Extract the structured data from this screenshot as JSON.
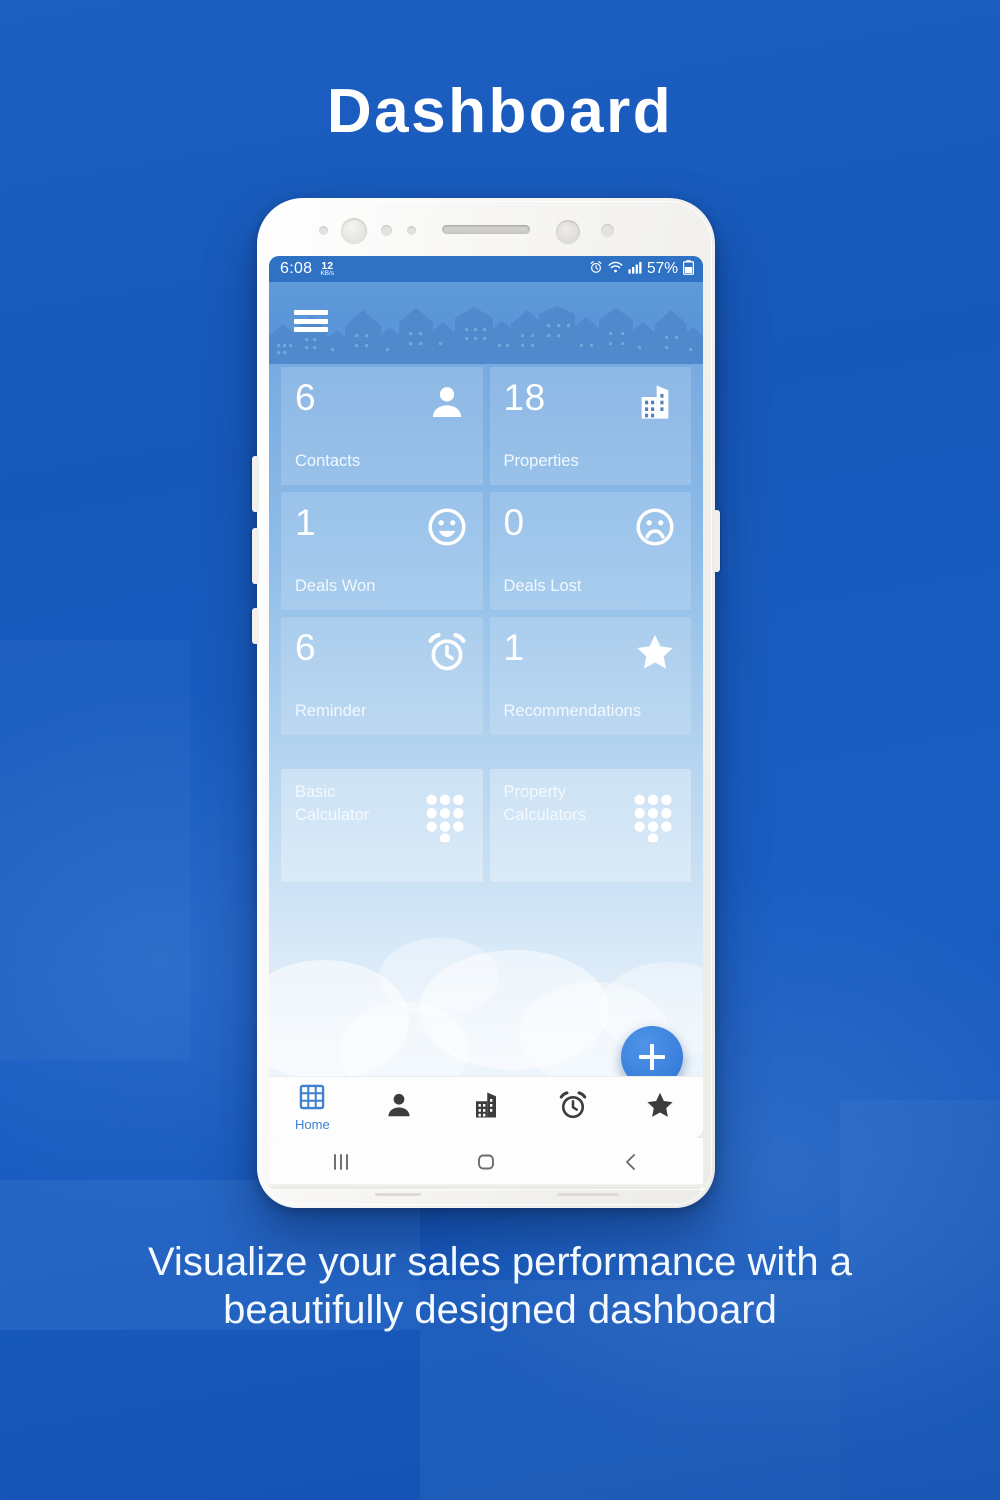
{
  "headline": "Dashboard",
  "caption": "Visualize your sales performance with a beautifully designed dashboard",
  "colors": {
    "background_blue": "#1759bb",
    "accent_blue": "#3c82dd",
    "tile_blue": "#5580c0",
    "calc_tile_blue": "#95b8dd",
    "appbar_blue": "#5793d6",
    "statusbar_blue": "#2f72c4",
    "nav_active_blue": "#3d7fd0"
  },
  "phone": {
    "status_bar": {
      "time": "6:08",
      "net_speed_value": "12",
      "net_speed_unit": "KB/s",
      "alarm_icon": "alarm-icon",
      "wifi_icon": "wifi-icon",
      "signal_icon": "signal-bars-icon",
      "battery_percent": "57%",
      "battery_icon": "battery-icon"
    },
    "app_bar": {
      "menu_icon": "hamburger-menu-icon",
      "banner_art": "city-skyline-silhouette"
    },
    "tiles": [
      {
        "value": "6",
        "label": "Contacts",
        "icon": "person-icon",
        "kind": "stat"
      },
      {
        "value": "18",
        "label": "Properties",
        "icon": "building-icon",
        "kind": "stat"
      },
      {
        "value": "1",
        "label": "Deals Won",
        "icon": "happy-face-icon",
        "kind": "stat"
      },
      {
        "value": "0",
        "label": "Deals Lost",
        "icon": "sad-face-icon",
        "kind": "stat"
      },
      {
        "value": "6",
        "label": "Reminder",
        "icon": "alarm-clock-icon",
        "kind": "stat"
      },
      {
        "value": "1",
        "label": "Recommendations",
        "icon": "star-icon",
        "kind": "stat"
      }
    ],
    "calc_tiles": [
      {
        "line1": "Basic",
        "line2": "Calculator",
        "icon": "keypad-dots-icon"
      },
      {
        "line1": "Property",
        "line2": "Calculators",
        "icon": "keypad-dots-icon"
      }
    ],
    "fab": {
      "label": "+",
      "icon": "plus-icon"
    },
    "bottom_nav": [
      {
        "label": "Home",
        "icon": "grid-home-icon",
        "active": true
      },
      {
        "label": "",
        "icon": "person-icon",
        "active": false
      },
      {
        "label": "",
        "icon": "building-icon",
        "active": false
      },
      {
        "label": "",
        "icon": "alarm-clock-icon",
        "active": false
      },
      {
        "label": "",
        "icon": "star-icon",
        "active": false
      }
    ],
    "android_nav": [
      {
        "icon": "recents-icon"
      },
      {
        "icon": "home-square-icon"
      },
      {
        "icon": "back-chevron-icon"
      }
    ]
  }
}
